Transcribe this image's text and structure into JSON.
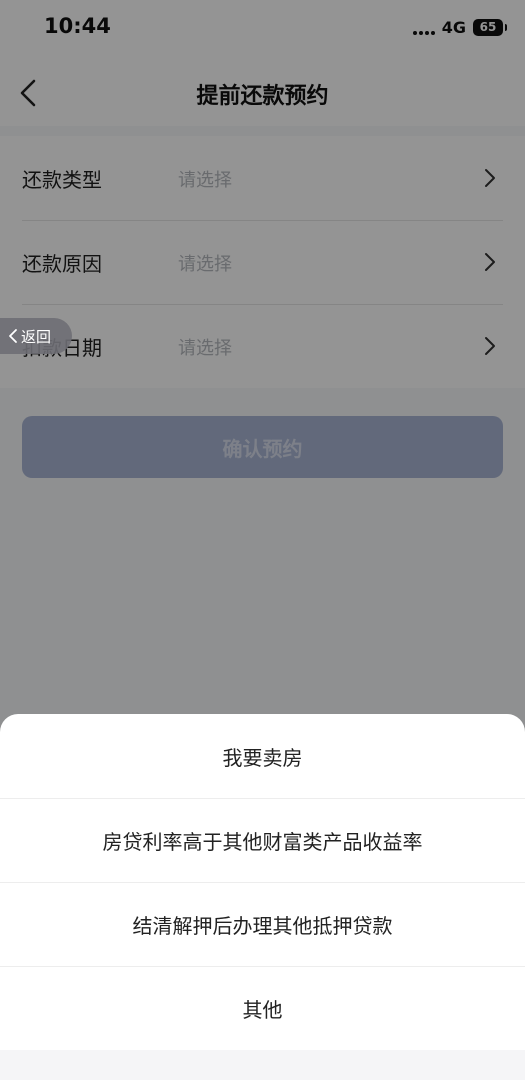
{
  "status_bar": {
    "time": "10:44",
    "network": "4G",
    "battery": "65"
  },
  "nav": {
    "title": "提前还款预约",
    "back_icon": "chevron-left-icon"
  },
  "form": {
    "rows": [
      {
        "label": "还款类型",
        "placeholder": "请选择"
      },
      {
        "label": "还款原因",
        "placeholder": "请选择"
      },
      {
        "label": "扣款日期",
        "placeholder": "请选择"
      }
    ],
    "confirm_label": "确认预约"
  },
  "float_back": {
    "label": "返回"
  },
  "sheet": {
    "options": [
      {
        "label": "我要卖房"
      },
      {
        "label": "房贷利率高于其他财富类产品收益率"
      },
      {
        "label": "结清解押后办理其他抵押贷款"
      },
      {
        "label": "其他"
      }
    ]
  },
  "colors": {
    "button_disabled": "#a9b6d4",
    "mask": "rgba(0,0,0,0.42)"
  }
}
